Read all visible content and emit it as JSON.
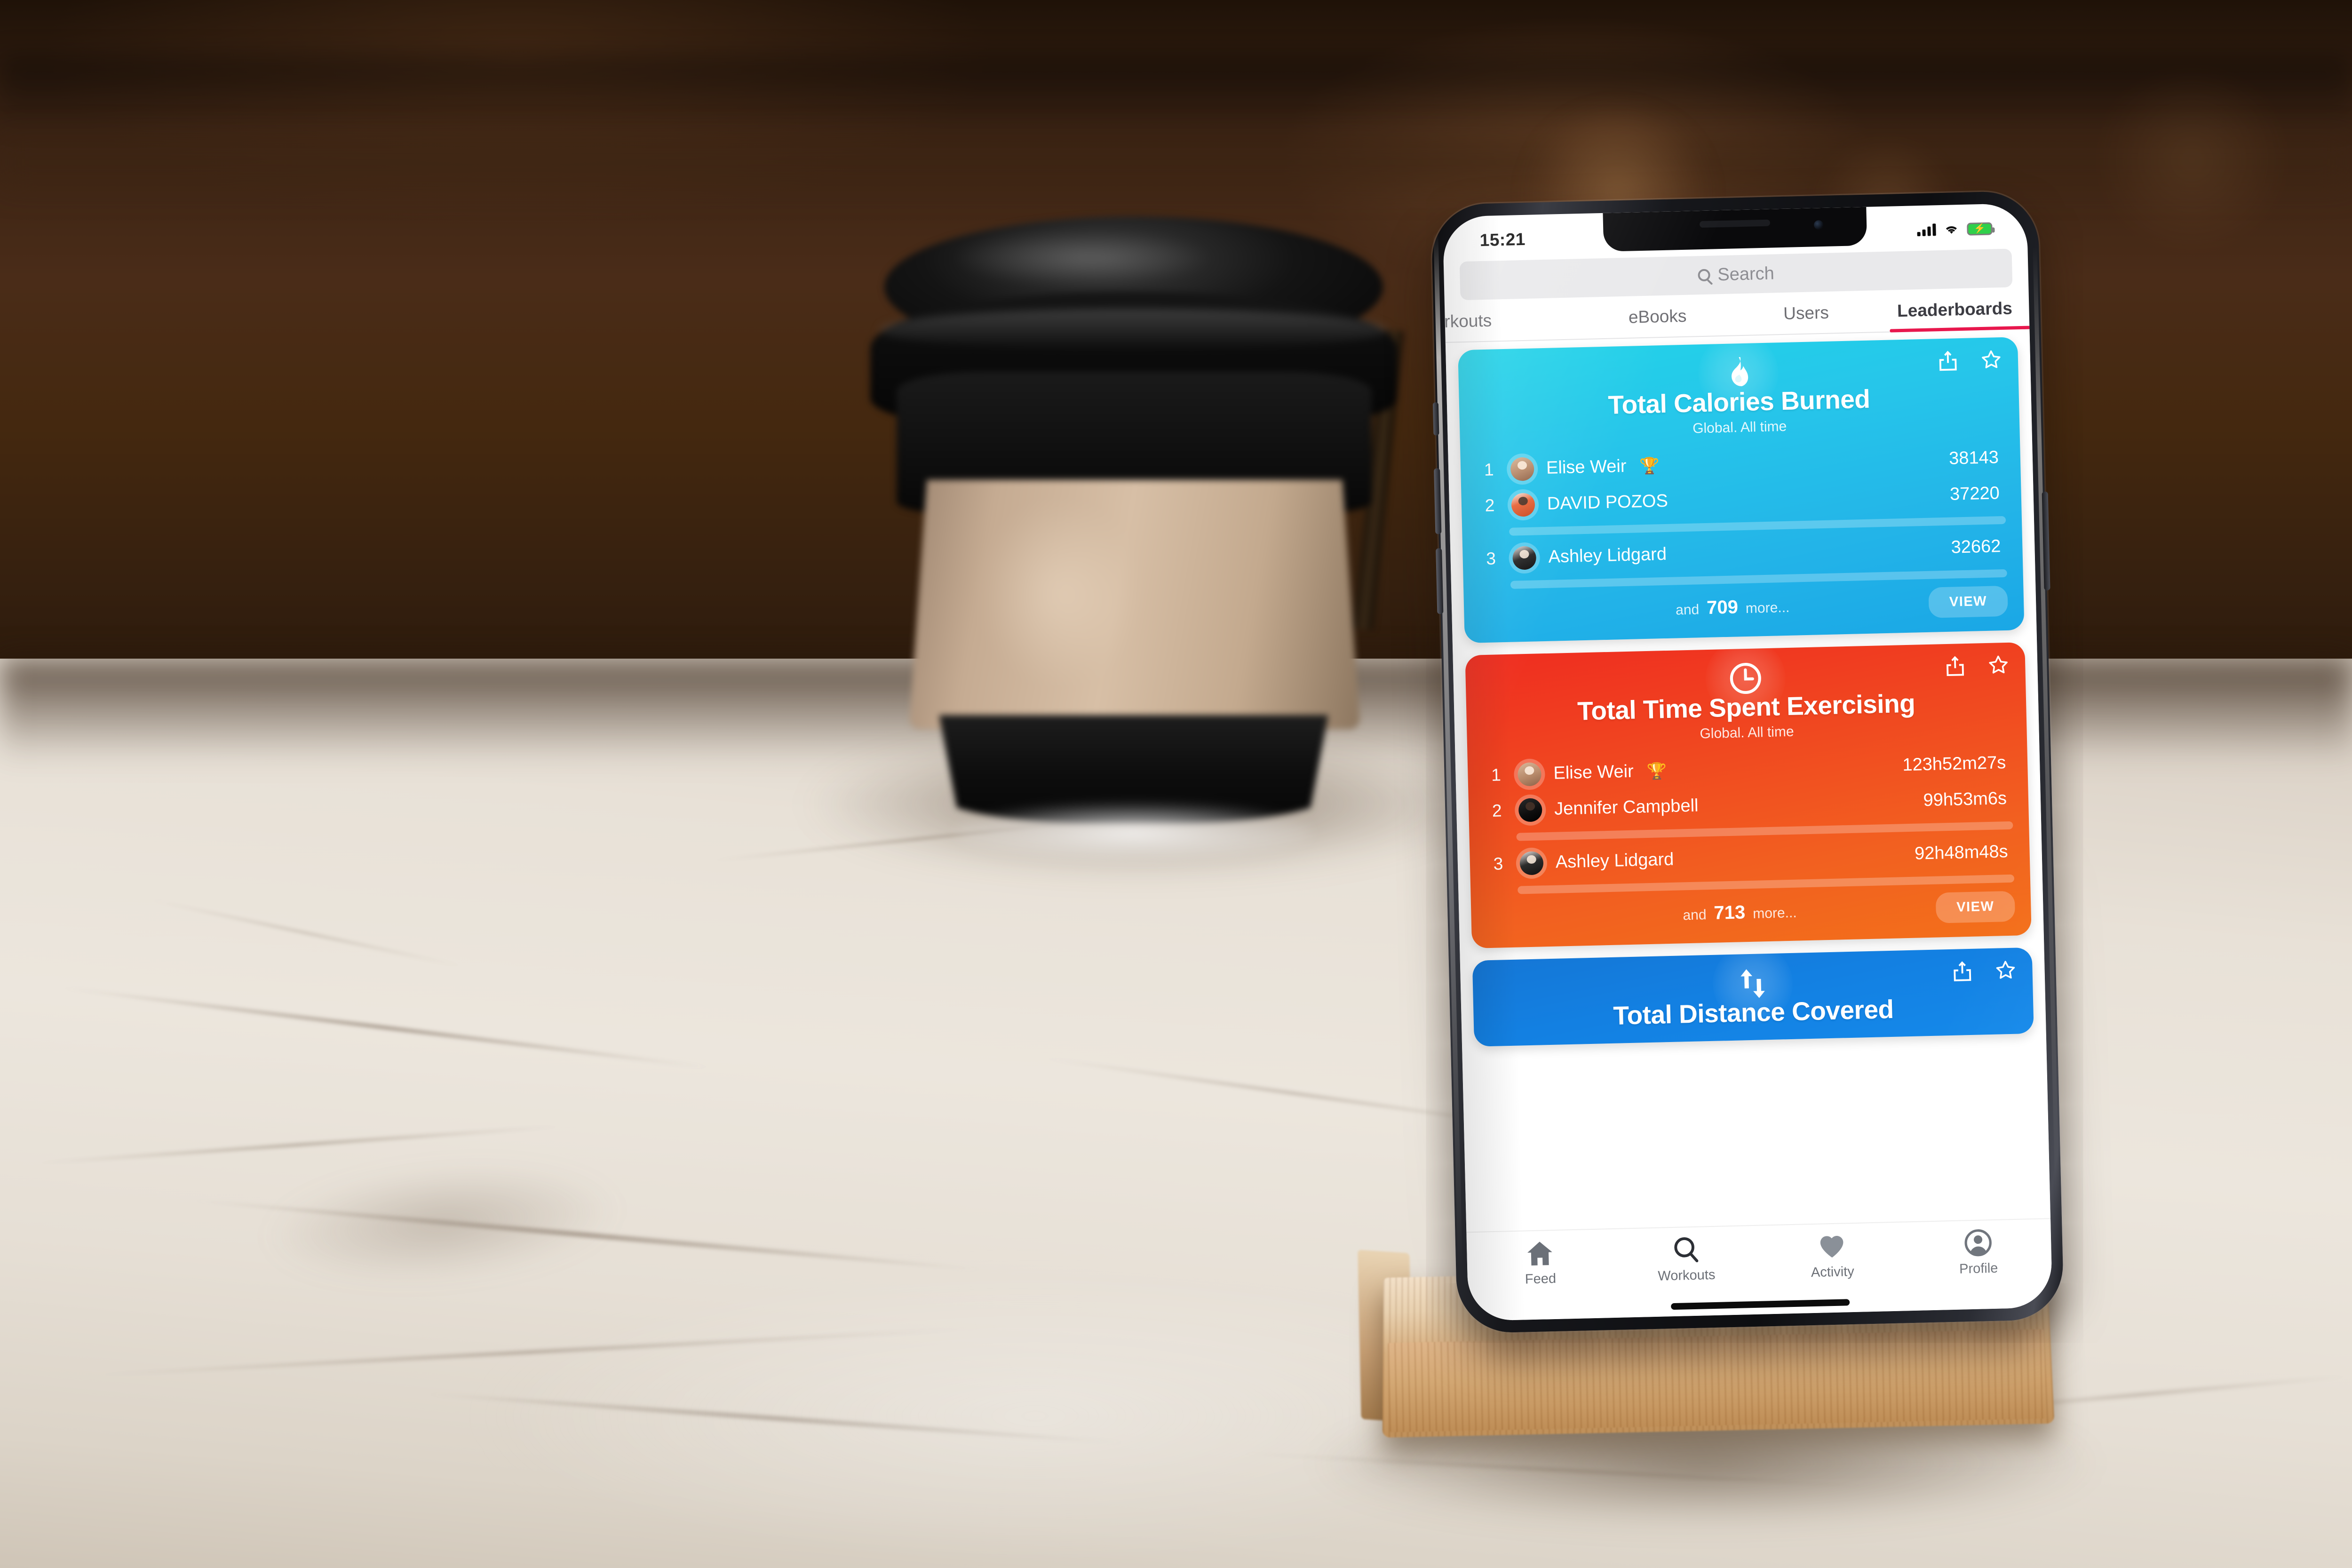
{
  "scene": {
    "background_color": "#3a2314",
    "table_color": "#ece6dd",
    "stand_color": "#d2a978",
    "cup_sleeve_color": "#d7bfa6"
  },
  "status_bar": {
    "time": "15:21",
    "cellular_icon": "signal-bars-icon",
    "wifi_icon": "wifi-icon",
    "battery_icon": "battery-charging-icon",
    "battery_color": "#2fd04a"
  },
  "search": {
    "placeholder": "Search",
    "icon": "search-icon"
  },
  "tabs": {
    "items": [
      {
        "label": "orkouts",
        "active": false,
        "clipped": true
      },
      {
        "label": "eBooks",
        "active": false
      },
      {
        "label": "Users",
        "active": false
      },
      {
        "label": "Leaderboards",
        "active": true
      }
    ],
    "active_indicator_color": "#e8174d"
  },
  "cards": [
    {
      "id": "total-calories-burned",
      "icon": "flame-icon",
      "title": "Total Calories Burned",
      "subtitle": "Global. All time",
      "accent": "#22d3e8",
      "share_icon": "share-icon",
      "favorite_icon": "star-outline-icon",
      "entries": [
        {
          "rank": "1",
          "name": "Elise Weir",
          "badge": "🏆",
          "score": "38143",
          "avatar": "avatar-elise"
        },
        {
          "rank": "2",
          "name": "DAVID POZOS",
          "badge": "",
          "score": "37220",
          "avatar": "avatar-david"
        },
        {
          "rank": "3",
          "name": "Ashley Lidgard",
          "badge": "",
          "score": "32662",
          "avatar": "avatar-ashley"
        }
      ],
      "footer": {
        "prefix": "and",
        "count": "709",
        "suffix": "more...",
        "button": "VIEW"
      }
    },
    {
      "id": "total-time-spent-exercising",
      "icon": "clock-icon",
      "title": "Total Time Spent Exercising",
      "subtitle": "Global. All time",
      "accent": "#f04520",
      "share_icon": "share-icon",
      "favorite_icon": "star-outline-icon",
      "entries": [
        {
          "rank": "1",
          "name": "Elise Weir",
          "badge": "🏆",
          "score": "123h52m27s",
          "avatar": "avatar-elise"
        },
        {
          "rank": "2",
          "name": "Jennifer Campbell",
          "badge": "",
          "score": "99h53m6s",
          "avatar": "avatar-jennifer"
        },
        {
          "rank": "3",
          "name": "Ashley Lidgard",
          "badge": "",
          "score": "92h48m48s",
          "avatar": "avatar-ashley"
        }
      ],
      "footer": {
        "prefix": "and",
        "count": "713",
        "suffix": "more...",
        "button": "VIEW"
      }
    },
    {
      "id": "total-distance-covered",
      "icon": "up-down-arrows-icon",
      "title": "Total Distance Covered",
      "subtitle": "",
      "accent": "#1380e2",
      "share_icon": "share-icon",
      "favorite_icon": "star-outline-icon",
      "entries": [],
      "footer": {
        "prefix": "",
        "count": "",
        "suffix": "",
        "button": ""
      }
    }
  ],
  "tabbar": {
    "items": [
      {
        "label": "Feed",
        "icon": "home-icon"
      },
      {
        "label": "Workouts",
        "icon": "search-icon"
      },
      {
        "label": "Activity",
        "icon": "heart-icon"
      },
      {
        "label": "Profile",
        "icon": "person-icon"
      }
    ]
  }
}
